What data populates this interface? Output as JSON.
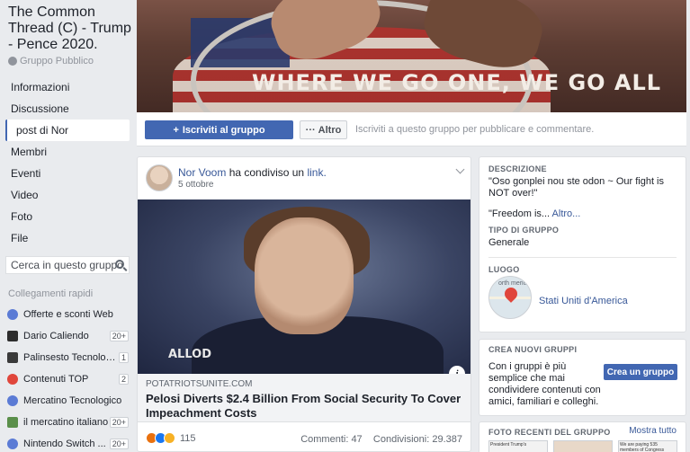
{
  "group": {
    "title": "The Common Thread (C) - Trump - Pence 2020.",
    "type": "Gruppo Pubblico"
  },
  "nav": {
    "items": [
      {
        "label": "Informazioni",
        "active": false
      },
      {
        "label": "Discussione",
        "active": false
      },
      {
        "label": "post di Nor",
        "active": true
      },
      {
        "label": "Membri",
        "active": false
      },
      {
        "label": "Eventi",
        "active": false
      },
      {
        "label": "Video",
        "active": false
      },
      {
        "label": "Foto",
        "active": false
      },
      {
        "label": "File",
        "active": false
      }
    ],
    "search_placeholder": "Cerca in questo gruppo"
  },
  "shortcuts": {
    "label": "Collegamenti rapidi",
    "items": [
      {
        "label": "Offerte e sconti Web",
        "badge": "",
        "icon": "group-icon",
        "color": "#5b7bd5"
      },
      {
        "label": "Dario Caliendo",
        "badge": "20+",
        "icon": "photo-thumb-icon",
        "color": "#2d2d2d"
      },
      {
        "label": "Palinsesto Tecnologia",
        "badge": "1",
        "icon": "photo-thumb-icon",
        "color": "#3a3a3a"
      },
      {
        "label": "Contenuti TOP",
        "badge": "2",
        "icon": "tomato-icon",
        "color": "#e0463b"
      },
      {
        "label": "Mercatino Tecnologico",
        "badge": "",
        "icon": "group-icon",
        "color": "#5b7bd5"
      },
      {
        "label": "il mercatino italiano",
        "badge": "20+",
        "icon": "photo-thumb-icon",
        "color": "#5a8f4a"
      },
      {
        "label": "Nintendo Switch ...",
        "badge": "20+",
        "icon": "group-icon",
        "color": "#5b7bd5"
      }
    ]
  },
  "cover": {
    "text": "WHERE WE GO ONE, WE GO ALL"
  },
  "actions": {
    "join_label": "Iscriviti al gruppo",
    "more_label": "Altro",
    "hint": "Iscriviti a questo gruppo per pubblicare e commentare."
  },
  "post": {
    "author": "Nor Voom",
    "shared_text": "ha condiviso un",
    "shared_link": "link.",
    "date": "5 ottobre",
    "image_watermark": "ALLOD",
    "link_domain": "POTATRIOTSUNITE.COM",
    "link_title": "Pelosi Diverts $2.4 Billion From Social Security To Cover Impeachment Costs",
    "reaction_count": "115",
    "comments": "Commenti: 47",
    "shares": "Condivisioni: 29.387"
  },
  "about": {
    "description_label": "DESCRIZIONE",
    "description_text": "\"Oso gonplei nou ste odon ~ Our fight is NOT over!\"",
    "description_more_prefix": "\"Freedom is...",
    "description_more_link": "Altro...",
    "type_label": "TIPO DI GRUPPO",
    "type_value": "Generale",
    "place_label": "LUOGO",
    "place_value": "Stati Uniti d'America",
    "map_text": "orth merica"
  },
  "create_groups": {
    "label": "CREA NUOVI GRUPPI",
    "text": "Con i gruppi è più semplice che mai condividere contenuti con amici, familiari e colleghi.",
    "button": "Crea un gruppo"
  },
  "photos": {
    "label": "FOTO RECENTI DEL GRUPPO",
    "show_all": "Mostra tutto",
    "thumbs": [
      "President Trump's",
      "",
      "We are paying 535 members of Congress"
    ]
  },
  "colors": {
    "accent": "#4267b2",
    "link": "#385898",
    "background": "#e9ebee"
  }
}
